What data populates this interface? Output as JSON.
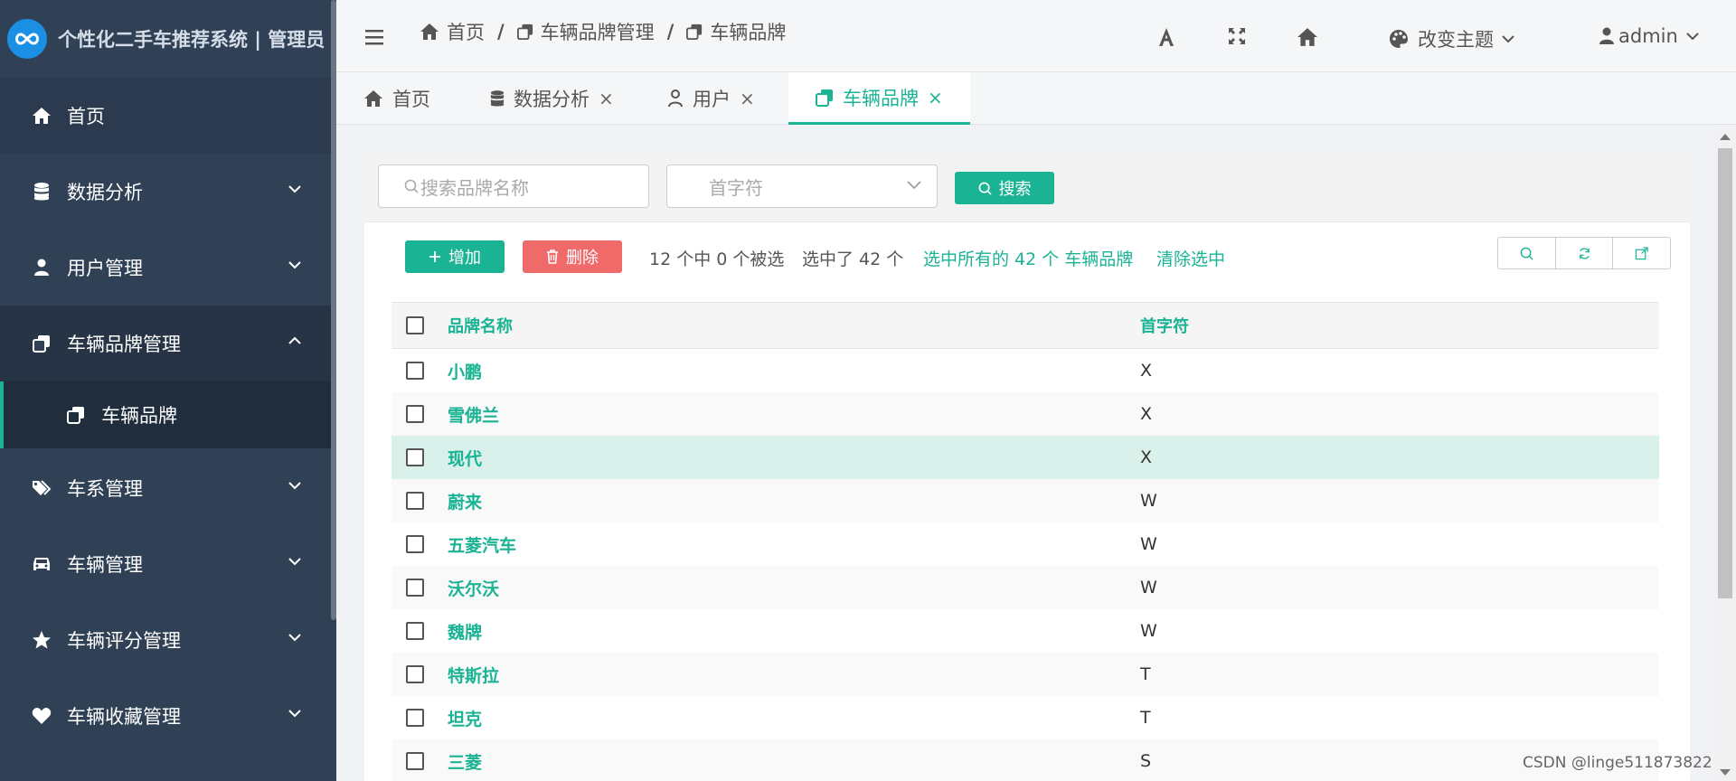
{
  "app": {
    "title": "个性化二手车推荐系统 | 管理员"
  },
  "sidebar": {
    "items": [
      {
        "label": "首页",
        "icon": "home-icon"
      },
      {
        "label": "数据分析",
        "icon": "database-icon"
      },
      {
        "label": "用户管理",
        "icon": "user-icon"
      },
      {
        "label": "车辆品牌管理",
        "icon": "clone-icon"
      },
      {
        "label": "车辆品牌",
        "icon": "clone-icon"
      },
      {
        "label": "车系管理",
        "icon": "tags-icon"
      },
      {
        "label": "车辆管理",
        "icon": "car-icon"
      },
      {
        "label": "车辆评分管理",
        "icon": "star-icon"
      },
      {
        "label": "车辆收藏管理",
        "icon": "heart-icon"
      }
    ]
  },
  "header": {
    "breadcrumb": [
      "首页",
      "车辆品牌管理",
      "车辆品牌"
    ],
    "separator": "/",
    "theme_label": "改变主题",
    "user_label": "admin"
  },
  "tabs": [
    {
      "label": "首页"
    },
    {
      "label": "数据分析",
      "close": "×"
    },
    {
      "label": "用户",
      "close": "×"
    },
    {
      "label": "车辆品牌",
      "close": "×"
    }
  ],
  "search": {
    "placeholder": "搜索品牌名称",
    "select_placeholder": "首字符",
    "button": "搜索"
  },
  "toolbar": {
    "add": "增加",
    "delete": "删除",
    "count_info": "12 个中 0 个被选",
    "selected_info": "选中了 42 个",
    "select_all": "选中所有的 42 个 车辆品牌",
    "clear": "清除选中"
  },
  "table": {
    "headers": [
      "品牌名称",
      "首字符"
    ],
    "rows": [
      {
        "name": "小鹏",
        "letter": "X"
      },
      {
        "name": "雪佛兰",
        "letter": "X"
      },
      {
        "name": "现代",
        "letter": "X"
      },
      {
        "name": "蔚来",
        "letter": "W"
      },
      {
        "name": "五菱汽车",
        "letter": "W"
      },
      {
        "name": "沃尔沃",
        "letter": "W"
      },
      {
        "name": "魏牌",
        "letter": "W"
      },
      {
        "name": "特斯拉",
        "letter": "T"
      },
      {
        "name": "坦克",
        "letter": "T"
      },
      {
        "name": "三菱",
        "letter": "S"
      }
    ]
  },
  "watermark": "CSDN @linge511873822",
  "colors": {
    "accent": "#1ab394",
    "sidebar": "#304156",
    "danger": "#f06a6a"
  }
}
